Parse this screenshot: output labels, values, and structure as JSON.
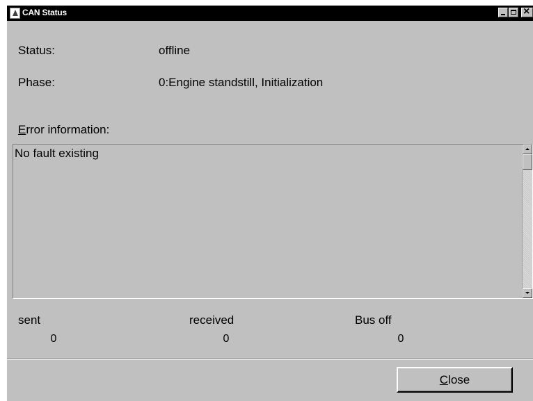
{
  "window": {
    "title": "CAN Status"
  },
  "status": {
    "label_prefix": "",
    "label": "Status:",
    "value": "offline"
  },
  "phase": {
    "label": "Phase:",
    "value": "0:Engine standstill, Initialization"
  },
  "error_information": {
    "label_mnemonic": "E",
    "label_rest": "rror information:",
    "text": "No fault existing"
  },
  "counters": [
    {
      "label": "sent",
      "value": "0"
    },
    {
      "label": "received",
      "value": "0"
    },
    {
      "label": "Bus off",
      "value": "0"
    }
  ],
  "close_button": {
    "mnemonic": "C",
    "rest": "lose"
  },
  "icons": {
    "app": "app-icon",
    "minimize": "minimize-icon",
    "maximize": "maximize-icon",
    "close": "close-icon"
  },
  "colors": {
    "titlebar": "#000000",
    "window_bg": "#c0c0c0"
  }
}
